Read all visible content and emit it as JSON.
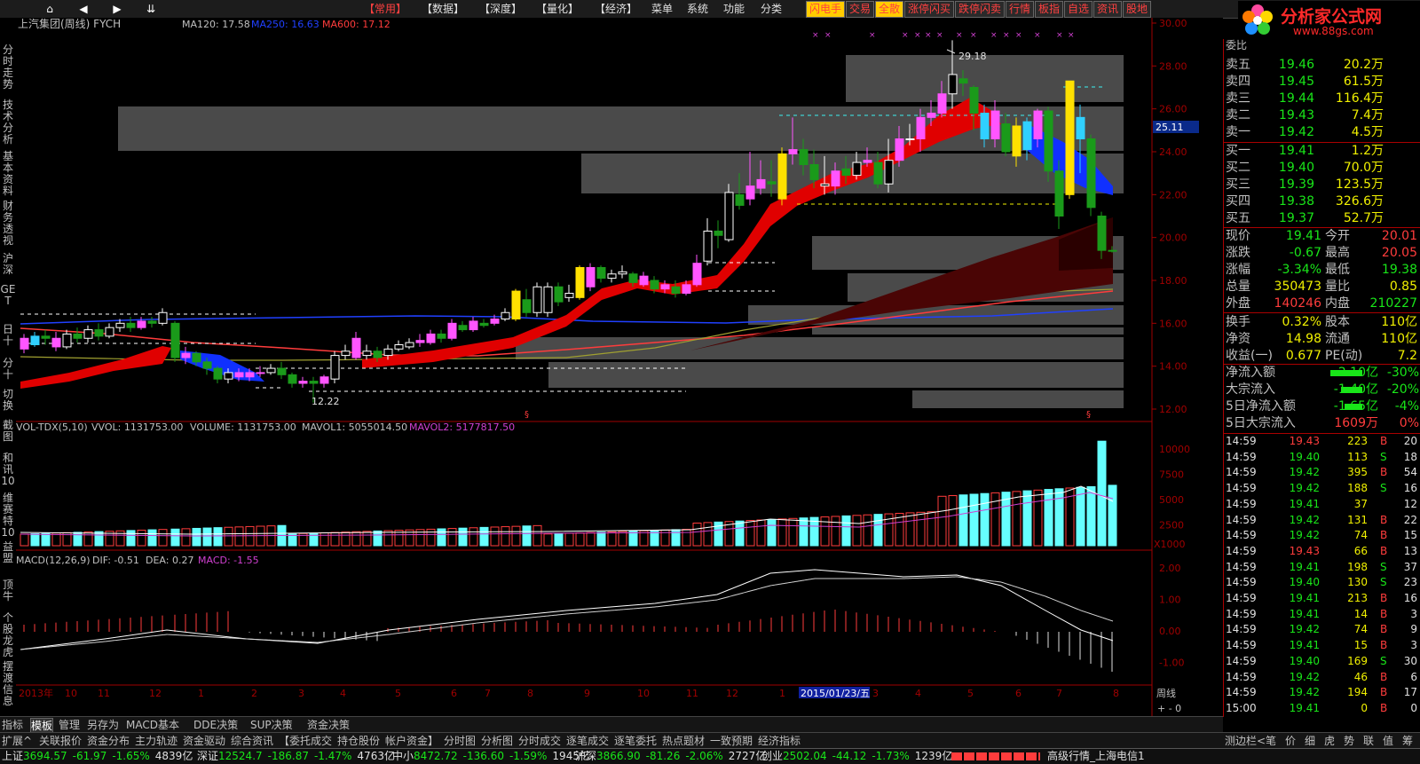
{
  "topbar": {
    "nav": [
      "⌂",
      "◀",
      "▶",
      "⇊"
    ],
    "menu": [
      {
        "label": "【常用】",
        "red": true
      },
      {
        "label": "【数据】",
        "red": false
      },
      {
        "label": "【深度】",
        "red": false
      },
      {
        "label": "【量化】",
        "red": false
      },
      {
        "label": "【经济】",
        "red": false
      },
      {
        "label": "菜单",
        "red": false
      },
      {
        "label": "系统",
        "red": false
      },
      {
        "label": "功能",
        "red": false
      },
      {
        "label": "分类",
        "red": false
      }
    ],
    "quick": [
      {
        "label": "闪电手",
        "color": "#ff4040",
        "bg": "#ffcc00"
      },
      {
        "label": "交易",
        "color": "#ff4040",
        "bg": "#2a2a2a"
      },
      {
        "label": "全散",
        "color": "#ff4040",
        "bg": "#ffcc00"
      },
      {
        "label": "涨停闪买",
        "color": "#ff4040",
        "bg": "#2a2a2a"
      },
      {
        "label": "跌停闪卖",
        "color": "#ff4040",
        "bg": "#2a2a2a"
      },
      {
        "label": "行情",
        "color": "#ff4040",
        "bg": "#2a2a2a"
      },
      {
        "label": "板指",
        "color": "#ff4040",
        "bg": "#2a2a2a"
      },
      {
        "label": "自选",
        "color": "#ff4040",
        "bg": "#2a2a2a"
      },
      {
        "label": "资讯",
        "color": "#ff4040",
        "bg": "#2a2a2a"
      },
      {
        "label": "股地",
        "color": "#ff4040",
        "bg": "#2a2a2a"
      }
    ]
  },
  "logo": {
    "title": "分析家公式网",
    "url": "www.88gs.com"
  },
  "sidebar": [
    "分时走势",
    "技术分析",
    "基本资料",
    "财务透视",
    "沪深",
    "GET",
    "日十",
    "分十",
    "切换",
    "截图",
    "和讯10",
    "维赛特10",
    "益盟",
    "顶牛",
    "个股龙虎",
    "摆渡信息"
  ],
  "chart": {
    "stock_title": "上汽集团(周线) FYCH",
    "ma120_label": "MA120: 17.58",
    "ma250_label": "MA250: 16.63",
    "ma600_label": "MA600: 17.12",
    "high_mark": "29.18",
    "low_mark": "12.22",
    "current_price_tag": "25.11",
    "price_axis": [
      "30.00",
      "28.00",
      "26.00",
      "24.00",
      "22.00",
      "20.00",
      "18.00",
      "16.00",
      "14.00",
      "12.00"
    ],
    "vol_header": {
      "name": "VOL-TDX(5,10)",
      "vvol": "VVOL: 1131753.00",
      "volume": "VOLUME: 1131753.00",
      "mavol1": "MAVOL1: 5055014.50",
      "mavol2": "MAVOL2: 5177817.50"
    },
    "vol_axis": [
      "10000",
      "7500",
      "5000",
      "2500"
    ],
    "vol_unit": "X1000",
    "macd_header": {
      "name": "MACD(12,26,9)",
      "dif": "DIF: -0.51",
      "dea": "DEA: 0.27",
      "macd": "MACD: -1.55"
    },
    "macd_axis": [
      "2.00",
      "1.00",
      "0.00",
      "-1.00"
    ],
    "time_axis": [
      "2013年",
      "10",
      "11",
      "12",
      "1",
      "2",
      "3",
      "4",
      "5",
      "6",
      "7",
      "8",
      "9",
      "10",
      "11",
      "12",
      "1",
      "2015/01/23/五",
      "3",
      "4",
      "5",
      "6",
      "7",
      "8"
    ],
    "period_label": "周线",
    "colors": {
      "up": "#ff3c3c",
      "down": "#00ffff",
      "ma120": "#ff3c3c",
      "ma250": "#2040ff",
      "ma600": "#ff3c3c",
      "axis": "#a00000"
    }
  },
  "quote": {
    "weibi": "委比",
    "sells": [
      {
        "label": "卖五",
        "price": "19.46",
        "vol": "20.2万"
      },
      {
        "label": "卖四",
        "price": "19.45",
        "vol": "61.5万"
      },
      {
        "label": "卖三",
        "price": "19.44",
        "vol": "116.4万"
      },
      {
        "label": "卖二",
        "price": "19.43",
        "vol": "7.4万"
      },
      {
        "label": "卖一",
        "price": "19.42",
        "vol": "4.5万"
      }
    ],
    "buys": [
      {
        "label": "买一",
        "price": "19.41",
        "vol": "1.2万"
      },
      {
        "label": "买二",
        "price": "19.40",
        "vol": "70.0万"
      },
      {
        "label": "买三",
        "price": "19.39",
        "vol": "123.5万"
      },
      {
        "label": "买四",
        "price": "19.38",
        "vol": "326.6万"
      },
      {
        "label": "买五",
        "price": "19.37",
        "vol": "52.7万"
      }
    ],
    "stats": [
      {
        "l1": "现价",
        "v1": "19.41",
        "c1": "green",
        "l2": "今开",
        "v2": "20.01",
        "c2": "red"
      },
      {
        "l1": "涨跌",
        "v1": "-0.67",
        "c1": "green",
        "l2": "最高",
        "v2": "20.05",
        "c2": "red"
      },
      {
        "l1": "涨幅",
        "v1": "-3.34%",
        "c1": "green",
        "l2": "最低",
        "v2": "19.38",
        "c2": "green"
      },
      {
        "l1": "总量",
        "v1": "350473",
        "c1": "yellow",
        "l2": "量比",
        "v2": "0.85",
        "c2": "yellow"
      },
      {
        "l1": "外盘",
        "v1": "140246",
        "c1": "red",
        "l2": "内盘",
        "v2": "210227",
        "c2": "green"
      },
      {
        "l1": "换手",
        "v1": "0.32%",
        "c1": "yellow",
        "l2": "股本",
        "v2": "110亿",
        "c2": "yellow"
      },
      {
        "l1": "净资",
        "v1": "14.98",
        "c1": "yellow",
        "l2": "流通",
        "v2": "110亿",
        "c2": "yellow"
      },
      {
        "l1": "收益(一)",
        "v1": "0.677",
        "c1": "yellow",
        "l2": "PE(动)",
        "v2": "7.2",
        "c2": "yellow"
      }
    ],
    "flows": [
      {
        "label": "净流入额",
        "value": "-2.10亿",
        "pct": "-30%",
        "bar": 36
      },
      {
        "label": "大宗流入",
        "value": "-1.40亿",
        "pct": "-20%",
        "bar": 24
      },
      {
        "label": "5日净流入额",
        "value": "-1.65亿",
        "pct": "-4%",
        "bar": 20
      },
      {
        "label": "5日大宗流入",
        "value": "1609万",
        "pct": "0%",
        "bar": 0
      }
    ],
    "ticks": [
      {
        "t": "14:59",
        "p": "19.43",
        "v": "223",
        "s": "B",
        "n": "20",
        "pc": "red"
      },
      {
        "t": "14:59",
        "p": "19.40",
        "v": "113",
        "s": "S",
        "n": "18",
        "pc": "green"
      },
      {
        "t": "14:59",
        "p": "19.42",
        "v": "395",
        "s": "B",
        "n": "54",
        "pc": "green"
      },
      {
        "t": "14:59",
        "p": "19.42",
        "v": "188",
        "s": "S",
        "n": "16",
        "pc": "green"
      },
      {
        "t": "14:59",
        "p": "19.41",
        "v": "37",
        "s": "",
        "n": "12",
        "pc": "green"
      },
      {
        "t": "14:59",
        "p": "19.42",
        "v": "131",
        "s": "B",
        "n": "22",
        "pc": "green"
      },
      {
        "t": "14:59",
        "p": "19.42",
        "v": "74",
        "s": "B",
        "n": "15",
        "pc": "green"
      },
      {
        "t": "14:59",
        "p": "19.43",
        "v": "66",
        "s": "B",
        "n": "13",
        "pc": "red"
      },
      {
        "t": "14:59",
        "p": "19.41",
        "v": "198",
        "s": "S",
        "n": "37",
        "pc": "green"
      },
      {
        "t": "14:59",
        "p": "19.40",
        "v": "130",
        "s": "S",
        "n": "23",
        "pc": "green"
      },
      {
        "t": "14:59",
        "p": "19.41",
        "v": "213",
        "s": "B",
        "n": "16",
        "pc": "green"
      },
      {
        "t": "14:59",
        "p": "19.41",
        "v": "14",
        "s": "B",
        "n": "3",
        "pc": "green"
      },
      {
        "t": "14:59",
        "p": "19.42",
        "v": "74",
        "s": "B",
        "n": "9",
        "pc": "green"
      },
      {
        "t": "14:59",
        "p": "19.41",
        "v": "15",
        "s": "B",
        "n": "3",
        "pc": "green"
      },
      {
        "t": "14:59",
        "p": "19.40",
        "v": "169",
        "s": "S",
        "n": "30",
        "pc": "green"
      },
      {
        "t": "14:59",
        "p": "19.42",
        "v": "46",
        "s": "B",
        "n": "6",
        "pc": "green"
      },
      {
        "t": "14:59",
        "p": "19.42",
        "v": "194",
        "s": "B",
        "n": "17",
        "pc": "green"
      },
      {
        "t": "15:00",
        "p": "19.41",
        "v": "0",
        "s": "B",
        "n": "0",
        "pc": "green"
      }
    ]
  },
  "bottom_tabs": [
    "指标",
    "模板",
    "管理",
    "另存为",
    "MACD基本",
    "DDE决策",
    "SUP决策",
    "资金决策"
  ],
  "bottom_tabs2": [
    "扩展^",
    "关联报价",
    "资金分布",
    "主力轨迹",
    "资金驱动",
    "综合资讯",
    "【委托成交",
    "持仓股份",
    "帐户资金】",
    "分时图",
    "分析图",
    "分时成交",
    "逐笔成交",
    "逐笔委托",
    "热点题材",
    "一致预期",
    "经济指标"
  ],
  "right_tabs": [
    "测边栏<",
    "笔",
    "价",
    "细",
    "虎",
    "势",
    "联",
    "值",
    "筹"
  ],
  "status": [
    {
      "name": "上证",
      "value": "3694.57",
      "chg": "-61.97",
      "pct": "-1.65%",
      "amt": "4839亿"
    },
    {
      "name": "深证",
      "value": "12524.7",
      "chg": "-186.87",
      "pct": "-1.47%",
      "amt": "4763亿"
    },
    {
      "name": "中小",
      "value": "8472.72",
      "chg": "-136.60",
      "pct": "-1.59%",
      "amt": "1945亿"
    },
    {
      "name": "沪深",
      "value": "3866.90",
      "chg": "-81.26",
      "pct": "-2.06%",
      "amt": "2727亿"
    },
    {
      "name": "创业",
      "value": "2502.04",
      "chg": "-44.12",
      "pct": "-1.73%",
      "amt": "1239亿"
    }
  ],
  "status_right": "高级行情_上海电信1"
}
